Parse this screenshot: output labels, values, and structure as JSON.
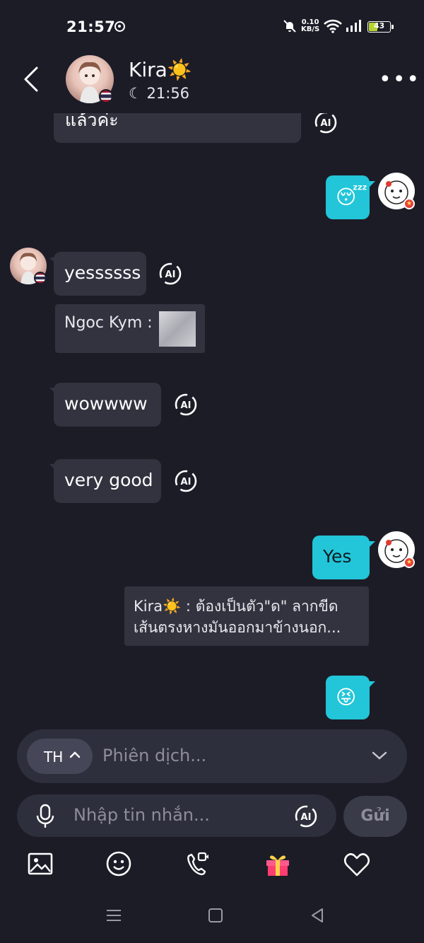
{
  "status_bar": {
    "time": "21:57",
    "net_speed_value": "0.10",
    "net_speed_unit": "KB/S",
    "battery": "43"
  },
  "header": {
    "contact_name": "Kira☀️",
    "last_seen": "21:56",
    "flag": "thailand"
  },
  "messages": {
    "partial_top": "แล้วค่ะ",
    "m1_text": "yessssss",
    "m1_quote_author": "Ngoc Kym :",
    "m2_text": "wowwww",
    "m3_text": "very good",
    "m4_text": "Yes",
    "m4_quote_author": "Kira☀️ :",
    "m4_quote_text": "ต้องเป็นตัว\"ด\" ลากขีดเส้นตรงหางมันออกมาข้างนอก...",
    "emoji_1": "😴",
    "emoji_2": "😝",
    "ai_label": "AI"
  },
  "composer": {
    "lang_code": "TH",
    "translate_placeholder": "Phiên dịch...",
    "input_placeholder": "Nhập tin nhắn...",
    "send_label": "Gửi",
    "ai_label": "AI"
  },
  "toolbar": {
    "items": [
      "image-icon",
      "emoji-icon",
      "video-call-icon",
      "gift-icon",
      "heart-icon"
    ]
  },
  "colors": {
    "background": "#1c1c27",
    "bubble_in": "#32333f",
    "bubble_out": "#22c6d8"
  }
}
